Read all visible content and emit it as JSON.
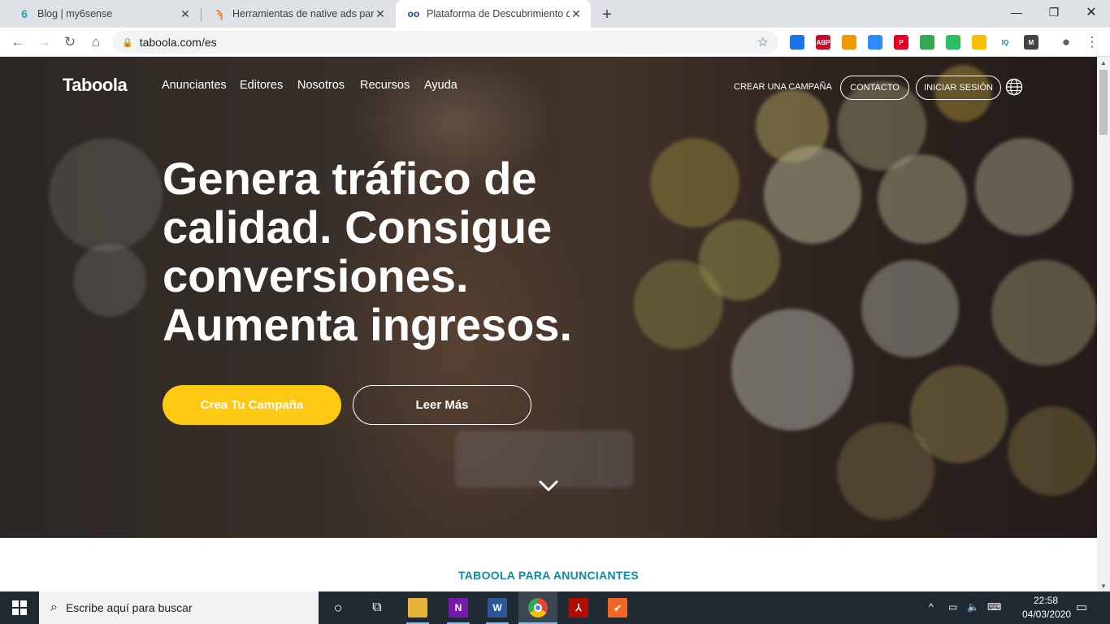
{
  "browser": {
    "tabs": [
      {
        "title": "Blog | my6sense",
        "favicon": "my6sense-icon",
        "active": false
      },
      {
        "title": "Herramientas de native ads para",
        "favicon": "tool-icon",
        "active": false
      },
      {
        "title": "Plataforma de Descubrimiento de",
        "favicon": "taboola-icon",
        "active": true
      }
    ],
    "url": "taboola.com/es",
    "extensions": [
      {
        "name": "cast-ext-icon",
        "label": "",
        "color": "#1a73e8"
      },
      {
        "name": "adblock-plus-icon",
        "label": "ABP",
        "color": "#c70d2c"
      },
      {
        "name": "key-ext-icon",
        "label": "",
        "color": "#f29900"
      },
      {
        "name": "zoom-ext-icon",
        "label": "",
        "color": "#2d8cff"
      },
      {
        "name": "pinterest-icon",
        "label": "P",
        "color": "#e60023"
      },
      {
        "name": "speed-ext-icon",
        "label": "",
        "color": "#34a853"
      },
      {
        "name": "evernote-icon",
        "label": "",
        "color": "#2dbe60"
      },
      {
        "name": "color-grid-icon",
        "label": "",
        "color": "#fbbc05"
      },
      {
        "name": "iq-ext-icon",
        "label": "IQ",
        "color": "#ffffff"
      },
      {
        "name": "m-ext-icon",
        "label": "M",
        "color": "#444444"
      }
    ]
  },
  "site": {
    "logo": "Taboola",
    "nav_left": [
      "Anunciantes",
      "Editores",
      "Nosotros",
      "Recursos",
      "Ayuda"
    ],
    "nav_right": {
      "create": "CREAR UNA CAMPAÑA",
      "contact": "CONTACTO",
      "login": "INICIAR SESIÓN"
    },
    "headline": "Genera tráfico de calidad. Consigue conversiones. Aumenta ingresos.",
    "cta_primary": "Crea Tu Campaña",
    "cta_secondary": "Leer Más",
    "section_label": "TABOOLA PARA ANUNCIANTES",
    "accent_yellow": "#ffc812",
    "accent_teal": "#0b8da3"
  },
  "taskbar": {
    "search_placeholder": "Escribe aquí para buscar",
    "time": "22:58",
    "date": "04/03/2020",
    "apps": [
      "file-explorer-icon",
      "onenote-icon",
      "word-icon",
      "chrome-icon",
      "acrobat-icon",
      "rocket-app-icon"
    ]
  }
}
